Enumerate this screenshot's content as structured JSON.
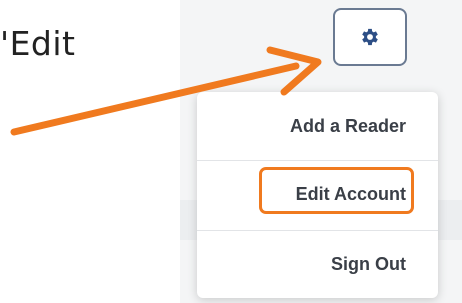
{
  "instruction": {
    "text": "'Edit"
  },
  "settings": {
    "icon": "gear-icon"
  },
  "menu": {
    "items": [
      {
        "label": "Add a Reader"
      },
      {
        "label": "Edit Account"
      },
      {
        "label": "Sign Out"
      }
    ]
  },
  "colors": {
    "accent": "#f07a1f",
    "icon": "#2d4f86"
  }
}
